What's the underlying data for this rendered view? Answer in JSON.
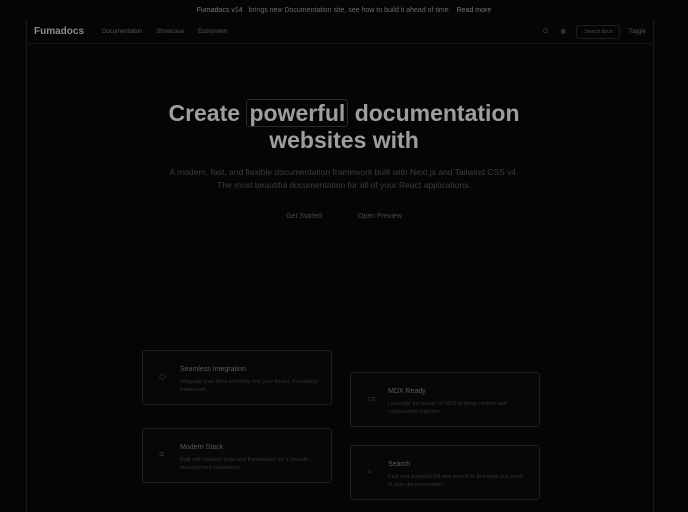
{
  "announcement": {
    "badge": "Fumadocs v14",
    "text": "brings new Documentation site, see how to build it ahead of time.",
    "link": "Read more"
  },
  "nav": {
    "logo": "Fumadocs",
    "links": [
      "Documentation",
      "Showcase",
      "Ecosystem"
    ],
    "search_placeholder": "Search docs",
    "theme_label": "Toggle"
  },
  "hero": {
    "title_pre": "Create",
    "title_highlight": "powerful",
    "title_post": "documentation",
    "title_line2": "websites with",
    "subtitle": "A modern, fast, and flexible documentation framework built with Next.js and Tailwind CSS v4. The most beautiful documentation for all of your React applications.",
    "cta_primary": "Get Started",
    "cta_secondary": "Open Preview"
  },
  "cards": [
    {
      "title": "Seamless Integration",
      "desc": "Integrate your docs smoothly into your React, Fumadocs framework.",
      "icon": "layers-icon"
    },
    {
      "title": "MDX Ready",
      "desc": "Leverage the power of MDX to bring content and components together.",
      "icon": "file-icon"
    },
    {
      "title": "Modern Stack",
      "desc": "Built with modern tools and frameworks for a smooth development experience.",
      "icon": "stack-icon"
    },
    {
      "title": "Search",
      "desc": "Fast and powerful full-text search to find what you need in your documentation.",
      "icon": "search-icon"
    }
  ]
}
